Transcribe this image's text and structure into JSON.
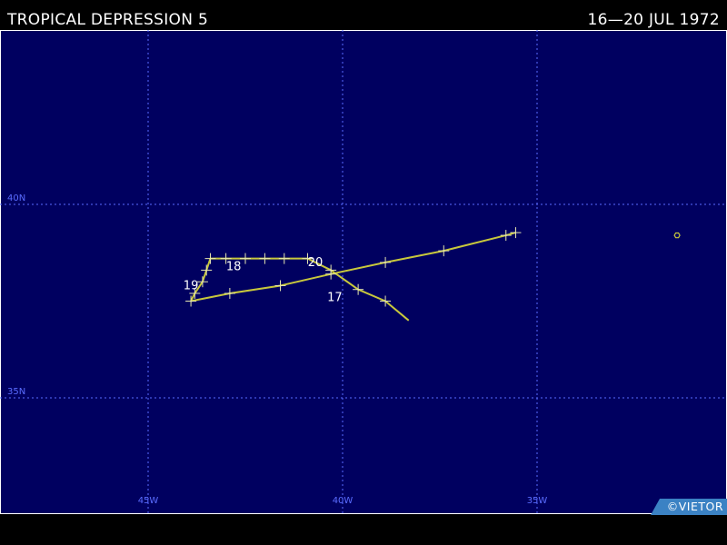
{
  "header": {
    "storm_name": "TROPICAL DEPRESSION 5",
    "date_range": "16—20 JUL 1972"
  },
  "grid": {
    "lon_labels": [
      "45W",
      "40W",
      "35W"
    ],
    "lat_labels": [
      "40N",
      "35N"
    ]
  },
  "track": {
    "points": [
      {
        "lon": -38.3,
        "lat": 37.0
      },
      {
        "lon": -38.9,
        "lat": 37.5
      },
      {
        "lon": -39.6,
        "lat": 37.8
      },
      {
        "lon": -40.3,
        "lat": 38.3
      },
      {
        "lon": -40.9,
        "lat": 38.6
      },
      {
        "lon": -41.5,
        "lat": 38.6
      },
      {
        "lon": -42.0,
        "lat": 38.6
      },
      {
        "lon": -42.5,
        "lat": 38.6
      },
      {
        "lon": -43.0,
        "lat": 38.6
      },
      {
        "lon": -43.4,
        "lat": 38.6
      },
      {
        "lon": -43.5,
        "lat": 38.3
      },
      {
        "lon": -43.6,
        "lat": 38.0
      },
      {
        "lon": -43.8,
        "lat": 37.7
      },
      {
        "lon": -43.9,
        "lat": 37.5
      },
      {
        "lon": -42.9,
        "lat": 37.7
      },
      {
        "lon": -41.6,
        "lat": 37.9
      },
      {
        "lon": -40.3,
        "lat": 38.2
      },
      {
        "lon": -38.9,
        "lat": 38.5
      },
      {
        "lon": -37.4,
        "lat": 38.8
      },
      {
        "lon": -35.8,
        "lat": 39.2
      },
      {
        "lon": -35.55,
        "lat": 39.27
      }
    ],
    "day_labels": [
      {
        "text": "17",
        "lon": -40.2,
        "lat": 37.5
      },
      {
        "text": "18",
        "lon": -42.8,
        "lat": 38.3
      },
      {
        "text": "19",
        "lon": -43.9,
        "lat": 37.8
      },
      {
        "text": "20",
        "lon": -40.7,
        "lat": 38.4
      }
    ],
    "fixed_marker": {
      "lon": -31.4,
      "lat": 39.2
    }
  },
  "credit": "©VIETOR",
  "colors": {
    "ocean": "#000060",
    "grid": "#5a6cff",
    "track": "#c8c83c",
    "text": "#ffffff",
    "badge": "#3b82c4"
  }
}
